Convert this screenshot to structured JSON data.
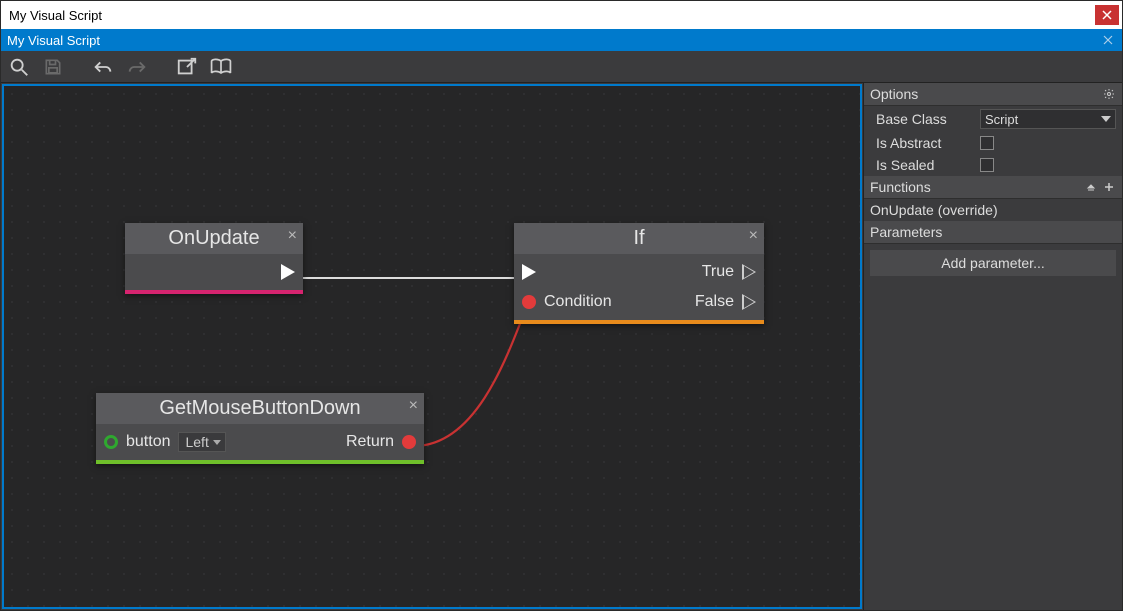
{
  "window": {
    "os_title": "My Visual Script",
    "inner_title": "My Visual Script"
  },
  "nodes": {
    "onupdate": {
      "title": "OnUpdate"
    },
    "ifnode": {
      "title": "If",
      "condition_label": "Condition",
      "true_label": "True",
      "false_label": "False"
    },
    "getmouse": {
      "title": "GetMouseButtonDown",
      "button_label": "button",
      "button_value": "Left",
      "return_label": "Return"
    }
  },
  "side": {
    "options_hdr": "Options",
    "base_class_label": "Base Class",
    "base_class_value": "Script",
    "is_abstract_label": "Is Abstract",
    "is_sealed_label": "Is Sealed",
    "functions_hdr": "Functions",
    "functions": [
      "OnUpdate (override)"
    ],
    "parameters_hdr": "Parameters",
    "add_parameter": "Add parameter..."
  }
}
